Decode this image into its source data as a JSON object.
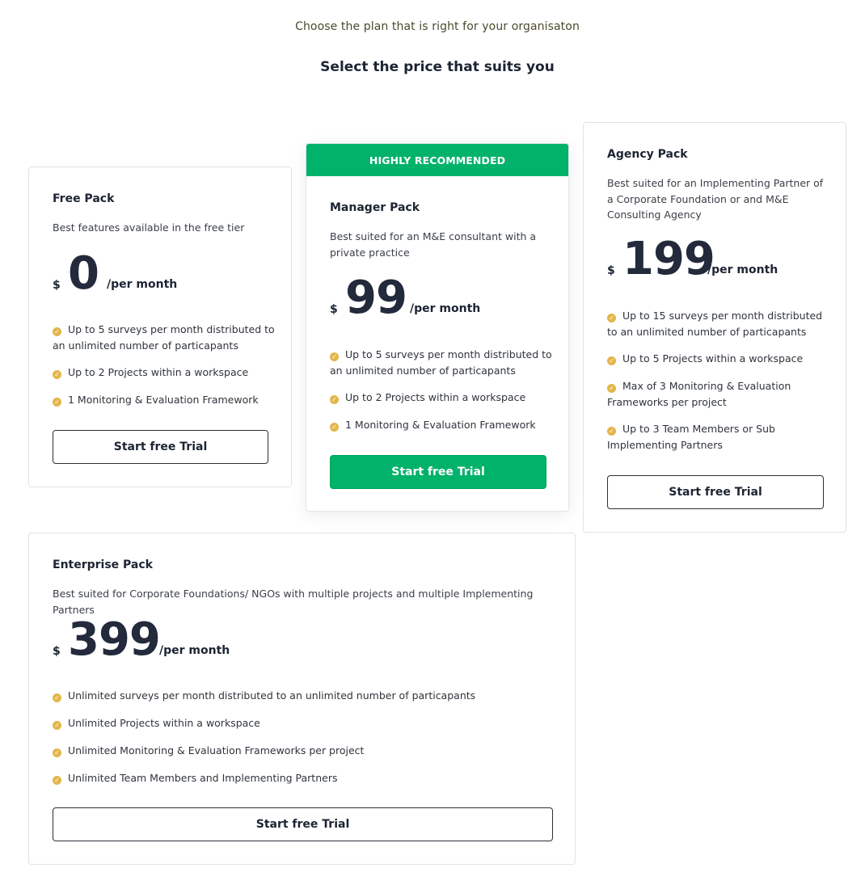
{
  "header": {
    "subtitle": "Choose the plan that is right for your organisaton",
    "title": "Select the price that suits you"
  },
  "colors": {
    "accent": "#00b26a",
    "check": "#e3b64a",
    "text": "#1c2433"
  },
  "plans": [
    {
      "name": "Free Pack",
      "description": "Best features available in the free tier",
      "currency": "$",
      "price": "0",
      "period": "/per month",
      "features": [
        "Up to 5 surveys per month distributed to an unlimited number of particapants",
        "Up to 2 Projects within a workspace",
        "1 Monitoring & Evaluation Framework"
      ],
      "cta": "Start free Trial"
    },
    {
      "badge": "HIGHLY RECOMMENDED",
      "name": "Manager Pack",
      "description": "Best suited for an M&E consultant with a private practice",
      "currency": "$",
      "price": "99",
      "period": "/per month",
      "features": [
        "Up to 5 surveys per month distributed to an unlimited number of particapants",
        "Up to 2 Projects within a workspace",
        "1 Monitoring & Evaluation Framework"
      ],
      "cta": "Start free Trial"
    },
    {
      "name": "Agency Pack",
      "description": "Best suited for an Implementing Partner of a Corporate Foundation or and M&E Consulting Agency",
      "currency": "$",
      "price": "199",
      "period": "/per month",
      "features": [
        "Up to 15 surveys per month distributed to an unlimited number of particapants",
        "Up to 5 Projects within a workspace",
        "Max of 3 Monitoring & Evaluation Frameworks per project",
        "Up to 3 Team Members or Sub Implementing Partners"
      ],
      "cta": "Start free Trial"
    },
    {
      "name": "Enterprise Pack",
      "description": "Best suited for Corporate Foundations/ NGOs with multiple projects and multiple Implementing Partners",
      "currency": "$",
      "price": "399",
      "period": "/per month",
      "features": [
        "Unlimited surveys per month distributed to an unlimited number of particapants",
        "Unlimited Projects within a workspace",
        "Unlimited Monitoring & Evaluation Frameworks per project",
        "Unlimited Team Members and Implementing Partners"
      ],
      "cta": "Start free Trial"
    }
  ]
}
